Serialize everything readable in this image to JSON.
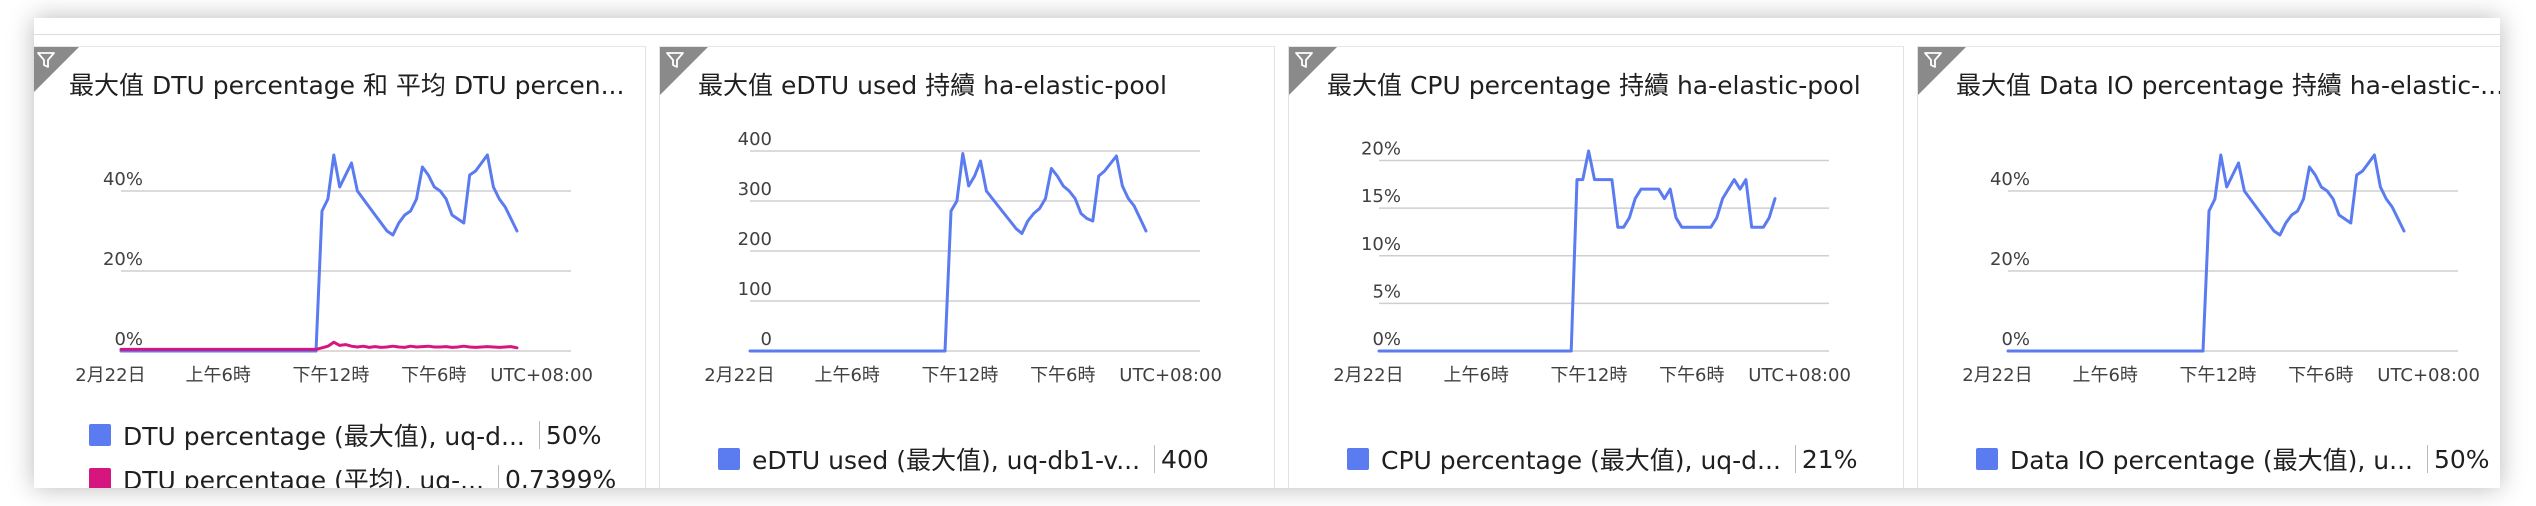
{
  "colors": {
    "blue": "#5b7bf0",
    "magenta": "#d6157f",
    "grid": "#cfcfcf"
  },
  "x_ticks": [
    "2月22日",
    "上午6時",
    "下午12時",
    "下午6時",
    "UTC+08:00"
  ],
  "tiles": [
    {
      "title": "最大值 DTU percentage 和 平均 DTU percen...",
      "y_ticks": [
        "40%",
        "20%",
        "0%"
      ],
      "legend": [
        {
          "label": "DTU percentage (最大值), uq-d...",
          "value": "50%"
        },
        {
          "label": "DTU percentage (平均), uq-...",
          "value": "0.7399%"
        }
      ],
      "chart_data": {
        "type": "line",
        "ylim": [
          0,
          50
        ],
        "y_tick_values": [
          40,
          20,
          0
        ],
        "series": [
          {
            "name": "DTU percentage (最大值), uq-d...",
            "color": "blue",
            "values": [
              0,
              0,
              0,
              0,
              0,
              0,
              0,
              0,
              0,
              0,
              0,
              0,
              0,
              0,
              0,
              0,
              0,
              0,
              0,
              0,
              0,
              0,
              0,
              0,
              0,
              0,
              0,
              0,
              0,
              0,
              0,
              0,
              0,
              0,
              35,
              38,
              49,
              41,
              44,
              47,
              40,
              38,
              36,
              34,
              32,
              30,
              29,
              32,
              34,
              35,
              38,
              46,
              44,
              41,
              40,
              38,
              34,
              33,
              32,
              44,
              45,
              47,
              49,
              41,
              38,
              36,
              33,
              30
            ]
          },
          {
            "name": "DTU percentage (平均), uq-...",
            "color": "magenta",
            "values": [
              0.4,
              0.4,
              0.4,
              0.4,
              0.4,
              0.4,
              0.4,
              0.4,
              0.4,
              0.4,
              0.4,
              0.4,
              0.4,
              0.4,
              0.4,
              0.4,
              0.4,
              0.4,
              0.4,
              0.4,
              0.4,
              0.4,
              0.4,
              0.4,
              0.4,
              0.4,
              0.4,
              0.4,
              0.4,
              0.4,
              0.4,
              0.4,
              0.4,
              0.4,
              0.8,
              1.2,
              2.2,
              1.4,
              1.6,
              1.2,
              1.0,
              1.2,
              0.9,
              1.1,
              0.9,
              1.0,
              1.2,
              1.0,
              0.9,
              1.2,
              1.0,
              1.1,
              1.2,
              1.0,
              1.0,
              1.1,
              0.9,
              1.0,
              1.2,
              1.0,
              0.9,
              1.0,
              1.1,
              1.0,
              0.9,
              1.0,
              1.1,
              0.8
            ]
          }
        ]
      }
    },
    {
      "title": "最大值 eDTU used 持續 ha-elastic-pool",
      "y_ticks": [
        "400",
        "300",
        "200",
        "100",
        "0"
      ],
      "legend": [
        {
          "label": "eDTU used (最大值), uq-db1-v...",
          "value": "400"
        }
      ],
      "chart_data": {
        "type": "line",
        "ylim": [
          0,
          400
        ],
        "y_tick_values": [
          400,
          300,
          200,
          100,
          0
        ],
        "series": [
          {
            "name": "eDTU used (最大值), uq-db1-v...",
            "color": "blue",
            "values": [
              0,
              0,
              0,
              0,
              0,
              0,
              0,
              0,
              0,
              0,
              0,
              0,
              0,
              0,
              0,
              0,
              0,
              0,
              0,
              0,
              0,
              0,
              0,
              0,
              0,
              0,
              0,
              0,
              0,
              0,
              0,
              0,
              0,
              0,
              280,
              300,
              395,
              330,
              350,
              380,
              320,
              305,
              290,
              275,
              260,
              245,
              235,
              260,
              275,
              285,
              305,
              365,
              350,
              330,
              320,
              305,
              275,
              265,
              260,
              350,
              360,
              375,
              390,
              330,
              305,
              290,
              265,
              240
            ]
          }
        ]
      }
    },
    {
      "title": "最大值 CPU percentage 持續 ha-elastic-pool",
      "y_ticks": [
        "20%",
        "15%",
        "10%",
        "5%",
        "0%"
      ],
      "legend": [
        {
          "label": "CPU percentage (最大值), uq-d...",
          "value": "21%"
        }
      ],
      "chart_data": {
        "type": "line",
        "ylim": [
          0,
          21
        ],
        "y_tick_values": [
          20,
          15,
          10,
          5,
          0
        ],
        "series": [
          {
            "name": "CPU percentage (最大值), uq-d...",
            "color": "blue",
            "values": [
              0,
              0,
              0,
              0,
              0,
              0,
              0,
              0,
              0,
              0,
              0,
              0,
              0,
              0,
              0,
              0,
              0,
              0,
              0,
              0,
              0,
              0,
              0,
              0,
              0,
              0,
              0,
              0,
              0,
              0,
              0,
              0,
              0,
              0,
              18,
              18,
              21,
              18,
              18,
              18,
              18,
              13,
              13,
              14,
              16,
              17,
              17,
              17,
              17,
              16,
              17,
              14,
              13,
              13,
              13,
              13,
              13,
              13,
              14,
              16,
              17,
              18,
              17,
              18,
              13,
              13,
              13,
              14,
              16
            ]
          }
        ]
      }
    },
    {
      "title": "最大值 Data IO percentage 持續 ha-elastic-...",
      "y_ticks": [
        "40%",
        "20%",
        "0%"
      ],
      "legend": [
        {
          "label": "Data IO percentage (最大值), u...",
          "value": "50%"
        }
      ],
      "chart_data": {
        "type": "line",
        "ylim": [
          0,
          50
        ],
        "y_tick_values": [
          40,
          20,
          0
        ],
        "series": [
          {
            "name": "Data IO percentage (最大值), u...",
            "color": "blue",
            "values": [
              0,
              0,
              0,
              0,
              0,
              0,
              0,
              0,
              0,
              0,
              0,
              0,
              0,
              0,
              0,
              0,
              0,
              0,
              0,
              0,
              0,
              0,
              0,
              0,
              0,
              0,
              0,
              0,
              0,
              0,
              0,
              0,
              0,
              0,
              35,
              38,
              49,
              41,
              44,
              47,
              40,
              38,
              36,
              34,
              32,
              30,
              29,
              32,
              34,
              35,
              38,
              46,
              44,
              41,
              40,
              38,
              34,
              33,
              32,
              44,
              45,
              47,
              49,
              41,
              38,
              36,
              33,
              30
            ]
          }
        ]
      }
    }
  ]
}
